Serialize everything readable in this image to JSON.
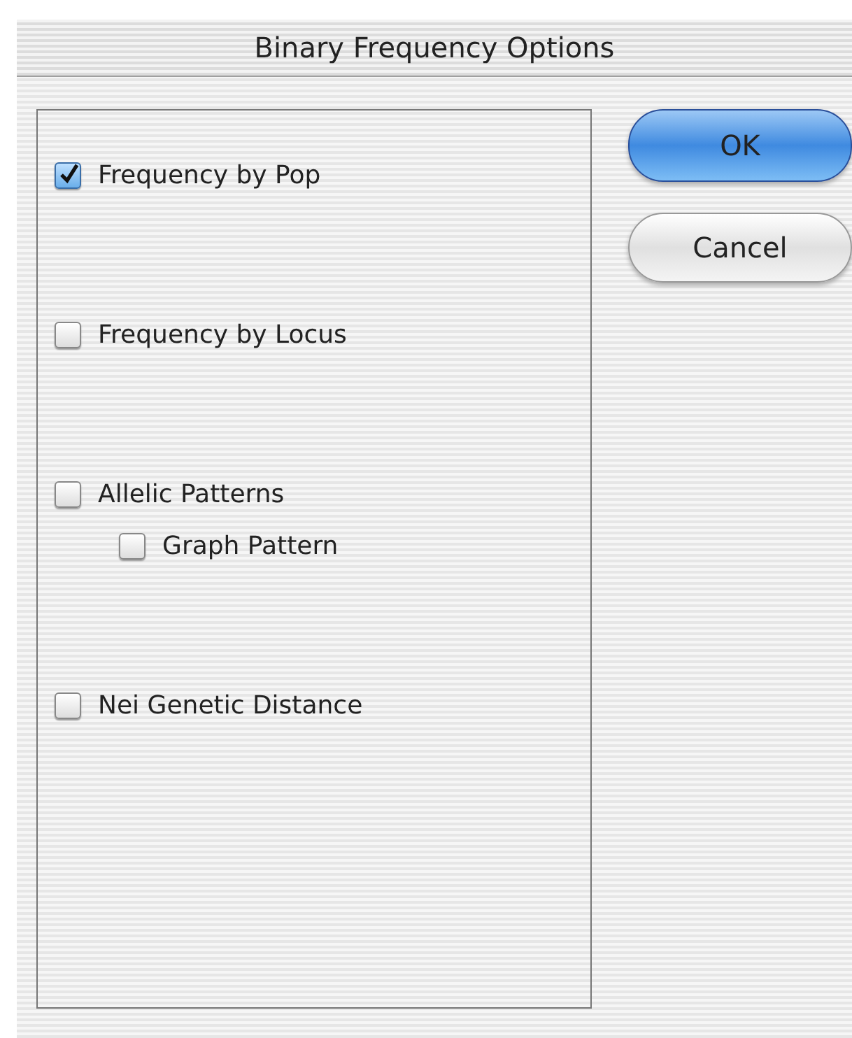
{
  "window": {
    "title": "Binary Frequency Options"
  },
  "options": [
    {
      "label": "Frequency by Pop",
      "checked": true
    },
    {
      "label": "Frequency by Locus",
      "checked": false
    },
    {
      "label": "Allelic Patterns",
      "checked": false,
      "children": [
        {
          "label": "Graph Pattern",
          "checked": false
        }
      ]
    },
    {
      "label": "Nei Genetic Distance",
      "checked": false
    }
  ],
  "buttons": [
    {
      "label": "OK",
      "default": true
    },
    {
      "label": "Cancel",
      "default": false
    }
  ]
}
